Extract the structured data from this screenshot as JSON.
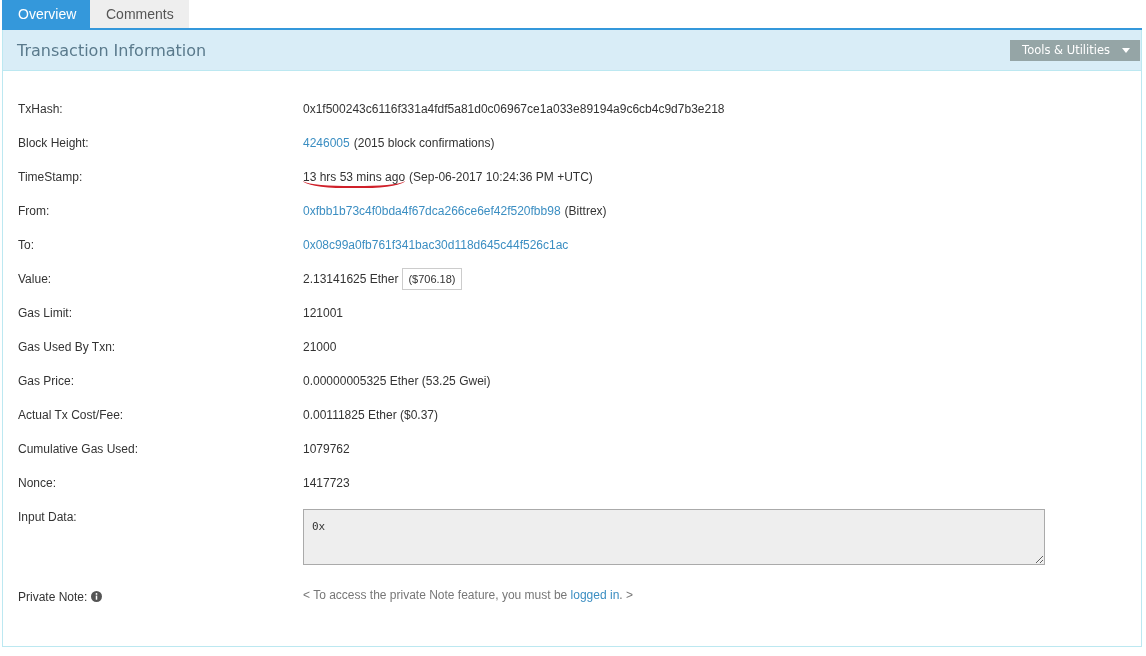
{
  "tabs": [
    {
      "label": "Overview",
      "selected": true
    },
    {
      "label": "Comments",
      "selected": false
    }
  ],
  "panel": {
    "title": "Transaction Information",
    "tools_button": "Tools & Utilities"
  },
  "rows": [
    {
      "kind": "text",
      "label": "TxHash:",
      "value": "0x1f500243c6116f331a4fdf5a81d0c06967ce1a033e89194a9c6cb4c9d7b3e218"
    },
    {
      "kind": "link",
      "label": "Block Height:",
      "link": "4246005",
      "suffix": "(2015 block confirmations)"
    },
    {
      "kind": "marked",
      "label": "TimeStamp:",
      "value": "13 hrs 53 mins ago",
      "suffix": "(Sep-06-2017 10:24:36 PM +UTC)"
    },
    {
      "kind": "link",
      "label": "From:",
      "link": "0xfbb1b73c4f0bda4f67dca266ce6ef42f520fbb98",
      "suffix": "(Bittrex)"
    },
    {
      "kind": "link",
      "label": "To:",
      "link": "0x08c99a0fb761f341bac30d118d645c44f526c1ac"
    },
    {
      "kind": "badge",
      "label": "Value:",
      "value": "2.13141625 Ether",
      "badge": "($706.18)"
    },
    {
      "kind": "text",
      "label": "Gas Limit:",
      "value": "121001"
    },
    {
      "kind": "text",
      "label": "Gas Used By Txn:",
      "value": "21000"
    },
    {
      "kind": "text",
      "label": "Gas Price:",
      "value": "0.00000005325 Ether (53.25 Gwei)"
    },
    {
      "kind": "text",
      "label": "Actual Tx Cost/Fee:",
      "value": "0.00111825 Ether ($0.37)"
    },
    {
      "kind": "text",
      "label": "Cumulative Gas Used:",
      "value": "1079762"
    },
    {
      "kind": "text",
      "label": "Nonce:",
      "value": "1417723"
    },
    {
      "kind": "textarea",
      "label": "Input Data:",
      "value": "0x"
    },
    {
      "kind": "note",
      "label": "Private Note:",
      "before": "< To access the private Note feature, you must be",
      "link": "logged in",
      "after": ". >"
    }
  ]
}
